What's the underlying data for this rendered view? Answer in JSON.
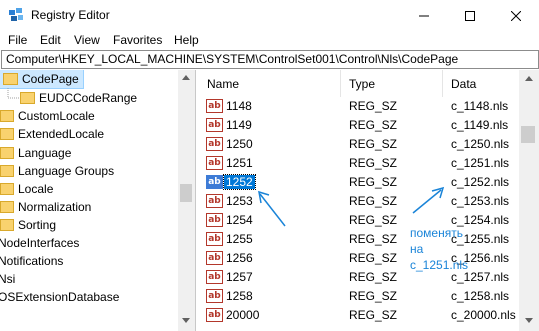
{
  "window": {
    "title": "Registry Editor",
    "icon": "registry-icon",
    "controls": [
      "minimize-icon",
      "maximize-icon",
      "close-icon"
    ]
  },
  "menu": [
    "File",
    "Edit",
    "View",
    "Favorites",
    "Help"
  ],
  "address": "Computer\\HKEY_LOCAL_MACHINE\\SYSTEM\\ControlSet001\\Control\\Nls\\CodePage",
  "tree": {
    "items": [
      {
        "label": "CodePage",
        "selected": true
      },
      {
        "label": "EUDCCodeRange"
      },
      {
        "label": "CustomLocale"
      },
      {
        "label": "ExtendedLocale"
      },
      {
        "label": "Language"
      },
      {
        "label": "Language Groups"
      },
      {
        "label": "Locale"
      },
      {
        "label": "Normalization"
      },
      {
        "label": "Sorting"
      },
      {
        "label": "NodeInterfaces"
      },
      {
        "label": "Notifications"
      },
      {
        "label": "Nsi"
      },
      {
        "label": "OSExtensionDatabase"
      }
    ]
  },
  "columns": [
    "Name",
    "Type",
    "Data"
  ],
  "rows": [
    {
      "name": "1148",
      "type": "REG_SZ",
      "data": "c_1148.nls"
    },
    {
      "name": "1149",
      "type": "REG_SZ",
      "data": "c_1149.nls"
    },
    {
      "name": "1250",
      "type": "REG_SZ",
      "data": "c_1250.nls"
    },
    {
      "name": "1251",
      "type": "REG_SZ",
      "data": "c_1251.nls"
    },
    {
      "name": "1252",
      "type": "REG_SZ",
      "data": "c_1252.nls",
      "selected": true
    },
    {
      "name": "1253",
      "type": "REG_SZ",
      "data": "c_1253.nls"
    },
    {
      "name": "1254",
      "type": "REG_SZ",
      "data": "c_1254.nls"
    },
    {
      "name": "1255",
      "type": "REG_SZ",
      "data": "c_1255.nls"
    },
    {
      "name": "1256",
      "type": "REG_SZ",
      "data": "c_1256.nls"
    },
    {
      "name": "1257",
      "type": "REG_SZ",
      "data": "c_1257.nls"
    },
    {
      "name": "1258",
      "type": "REG_SZ",
      "data": "c_1258.nls"
    },
    {
      "name": "20000",
      "type": "REG_SZ",
      "data": "c_20000.nls"
    }
  ],
  "value_icon_text": "ab",
  "annotation": {
    "lines": [
      "поменять",
      "на",
      "c_1251.nls"
    ],
    "color": "#1a84d8"
  },
  "colors": {
    "selection": "#0078d7",
    "tree_selection": "#cce8ff"
  }
}
